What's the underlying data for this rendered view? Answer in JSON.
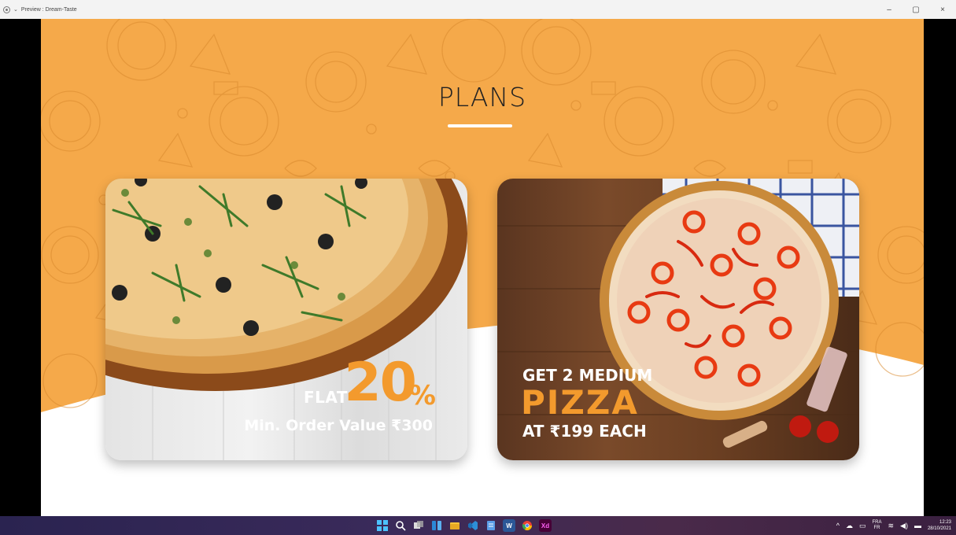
{
  "window": {
    "title": "Preview : Dream-Taste",
    "controls": {
      "minimize": "–",
      "maximize": "▢",
      "close": "×"
    }
  },
  "plans": {
    "title": "PLANS",
    "colors": {
      "orange": "#f5a94a",
      "accent": "#f39a2d",
      "white": "#ffffff"
    },
    "cards": [
      {
        "flat_label": "FLAT",
        "discount_number": "20",
        "discount_symbol": "%",
        "min_order": "Min. Order Value ₹300"
      },
      {
        "line1": "GET 2 MEDIUM",
        "line2": "PIZZA",
        "line3": "AT  ₹199 EACH"
      }
    ]
  },
  "taskbar": {
    "apps": [
      "windows-start",
      "search",
      "task-view",
      "widgets",
      "file-explorer",
      "vscode",
      "notepad",
      "word",
      "chrome",
      "adobe-xd"
    ],
    "xd_label": "Xd",
    "word_label": "W",
    "language": {
      "primary": "FRA",
      "secondary": "FR"
    },
    "time": "12:23",
    "date": "28/10/2021"
  }
}
